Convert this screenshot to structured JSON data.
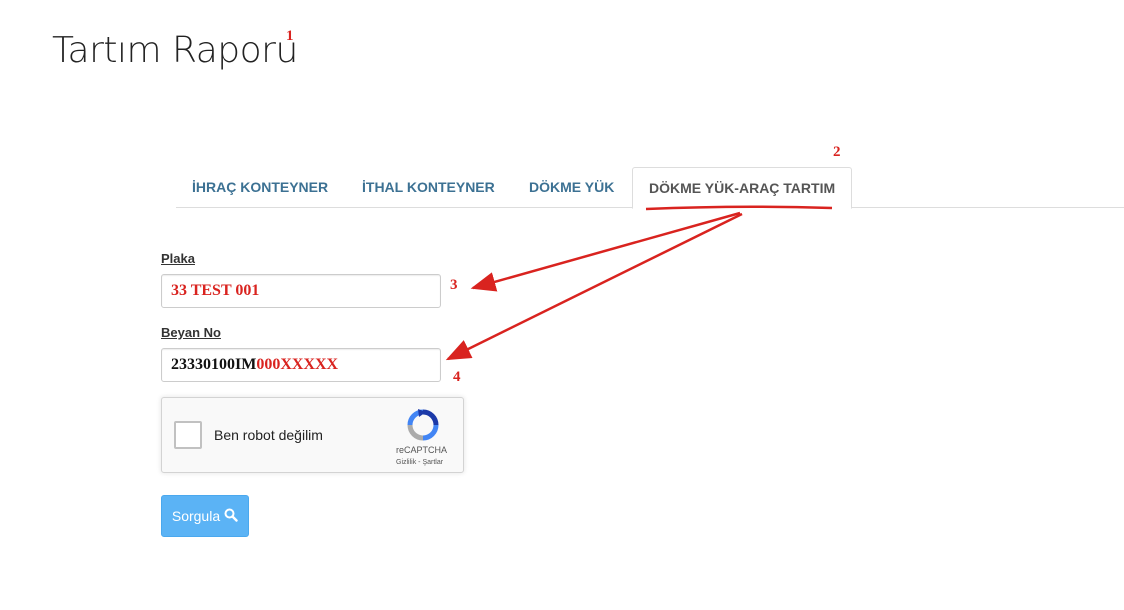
{
  "page": {
    "title": "Tartım Raporu"
  },
  "annotations": [
    "1",
    "2",
    "3",
    "4"
  ],
  "tabs": [
    {
      "label": "İHRAÇ KONTEYNER",
      "active": false
    },
    {
      "label": "İTHAL KONTEYNER",
      "active": false
    },
    {
      "label": "DÖKME YÜK",
      "active": false
    },
    {
      "label": "DÖKME YÜK-ARAÇ TARTIM",
      "active": true
    }
  ],
  "form": {
    "plaka_label": "Plaka",
    "plaka_value": "33 TEST 001",
    "beyan_label": "Beyan No",
    "beyan_value_prefix": "23330100IM",
    "beyan_value_suffix": "000XXXXX"
  },
  "captcha": {
    "label": "Ben robot değilim",
    "brand": "reCAPTCHA",
    "links": "Gizlilik - Şartlar",
    "checked": false
  },
  "search_button": {
    "label": "Sorgula",
    "icon": "search-icon"
  },
  "colors": {
    "annotation": "#d9231f",
    "tab_link": "#3c7193",
    "button": "#5bb3f5"
  }
}
